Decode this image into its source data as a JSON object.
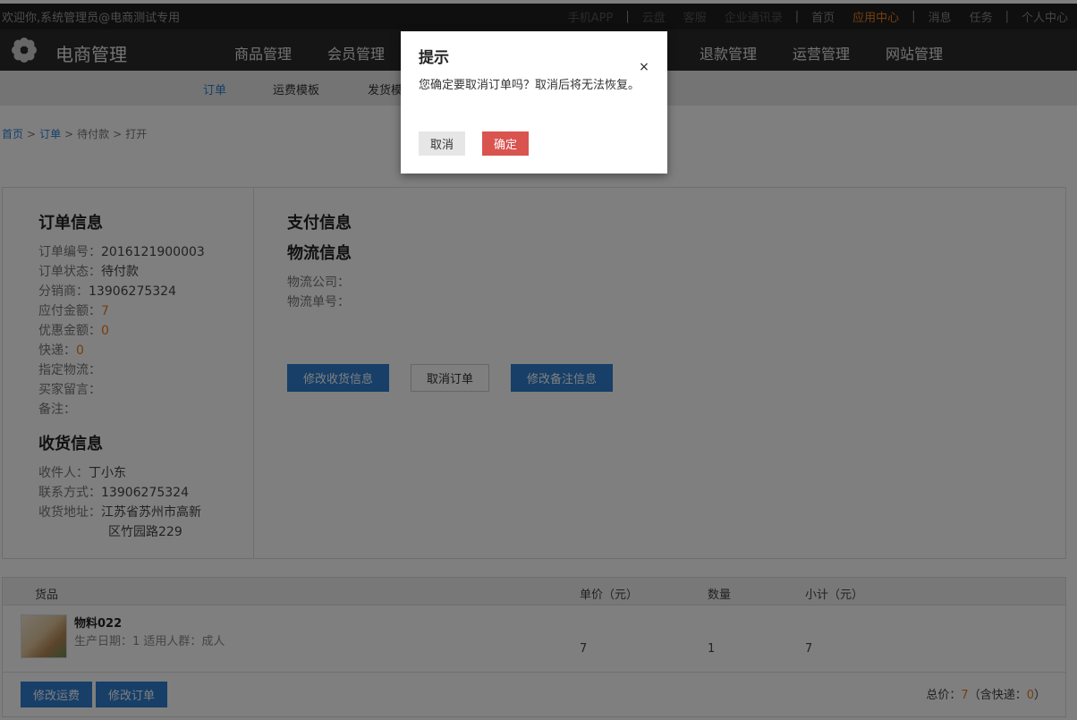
{
  "topbar": {
    "welcome": "欢迎你,系统管理员@电商测试专用",
    "links": [
      "手机APP",
      "云盘",
      "客服",
      "企业通讯录",
      "首页",
      "应用中心",
      "消息",
      "任务",
      "个人中心"
    ]
  },
  "mainnav": {
    "brand": "电商管理",
    "items": [
      "商品管理",
      "会员管理",
      "退款管理",
      "运营管理",
      "网站管理"
    ]
  },
  "subnav": {
    "items": [
      "订单",
      "运费模板",
      "发货模"
    ]
  },
  "breadcrumb": {
    "home": "首页",
    "orders": "订单",
    "status": "待付款",
    "current": "打开"
  },
  "order_info": {
    "title": "订单信息",
    "fields": [
      {
        "label": "订单编号：",
        "value": "2016121900003"
      },
      {
        "label": "订单状态：",
        "value": "待付款"
      },
      {
        "label": "分销商：",
        "value": "13906275324"
      },
      {
        "label": "应付金额：",
        "value": "7"
      },
      {
        "label": "优惠金额：",
        "value": "0"
      },
      {
        "label": "快递：",
        "value": "0"
      },
      {
        "label": "指定物流：",
        "value": ""
      },
      {
        "label": "买家留言：",
        "value": ""
      },
      {
        "label": "备注：",
        "value": ""
      }
    ]
  },
  "shipping_info": {
    "title": "收货信息",
    "fields": [
      {
        "label": "收件人：",
        "value": "丁小东"
      },
      {
        "label": "联系方式：",
        "value": "13906275324"
      },
      {
        "label": "收货地址：",
        "value_line1": "江苏省苏州市高新",
        "value_line2": "区竹园路229"
      }
    ]
  },
  "payment_info": {
    "title": "支付信息"
  },
  "logistics_info": {
    "title": "物流信息",
    "company_label": "物流公司：",
    "tracking_label": "物流单号："
  },
  "actions": {
    "edit_shipping": "修改收货信息",
    "cancel_order": "取消订单",
    "edit_note": "修改备注信息"
  },
  "table": {
    "headers": [
      "货品",
      "单价（元）",
      "数量",
      "小计（元）"
    ],
    "rows": [
      {
        "name": "物料022",
        "meta": "生产日期：1   适用人群：成人",
        "price": "7",
        "qty": "1",
        "subtotal": "7"
      }
    ],
    "footer_buttons": [
      "修改运费",
      "修改订单"
    ],
    "total_prefix": "总价：",
    "total": "7",
    "shipping_prefix": "（含快递：",
    "shipping": "0",
    "shipping_suffix": "）"
  },
  "modal": {
    "title": "提示",
    "close": "×",
    "message": "您确定要取消订单吗？取消后将无法恢复。",
    "cancel": "取消",
    "confirm": "确定"
  },
  "colors": {
    "primary": "#2e7fd1",
    "danger": "#d9534f",
    "accent": "#e67e22"
  }
}
